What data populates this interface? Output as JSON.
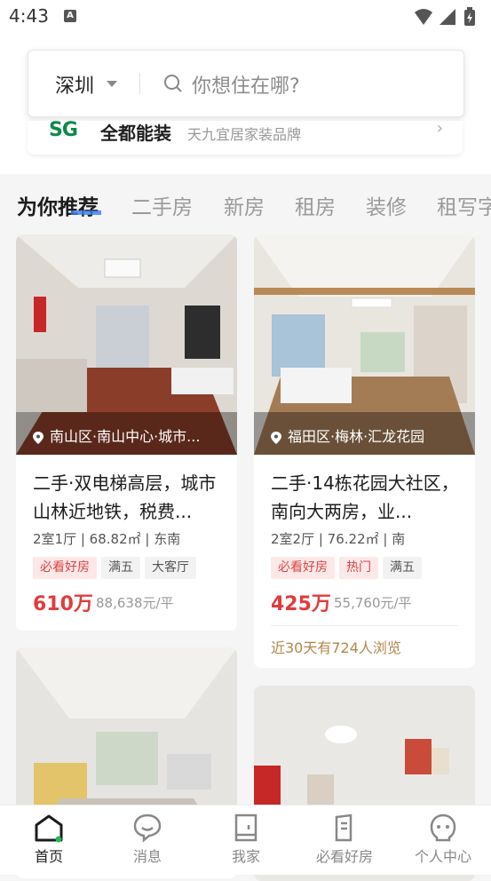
{
  "status_bar": {
    "time": "4:43",
    "notif_glyph": "A"
  },
  "search": {
    "city": "深圳",
    "placeholder": "你想住在哪?"
  },
  "banner": {
    "logo": "SG",
    "title": "全都能装",
    "subtitle": "天九宜居家装品牌"
  },
  "tabs": [
    {
      "label": "为你推荐",
      "active": true
    },
    {
      "label": "二手房"
    },
    {
      "label": "新房"
    },
    {
      "label": "租房"
    },
    {
      "label": "装修"
    },
    {
      "label": "租写字楼"
    }
  ],
  "listings": [
    {
      "location": "南山区·南山中心·城市...",
      "title": "二手·双电梯高层，城市山林近地铁，税费...",
      "info": "2室1厅 | 68.82㎡ | 东南",
      "tags": [
        {
          "label": "必看好房",
          "type": "hot"
        },
        {
          "label": "满五"
        },
        {
          "label": "大客厅"
        }
      ],
      "price": "610万",
      "unit_price": "88,638元/平"
    },
    {
      "location": "福田区·梅林·汇龙花园",
      "title": "二手·14栋花园大社区，南向大两房，业...",
      "info": "2室2厅 | 76.22㎡ | 南",
      "tags": [
        {
          "label": "必看好房",
          "type": "hot"
        },
        {
          "label": "热门",
          "type": "hot"
        },
        {
          "label": "满五"
        }
      ],
      "price": "425万",
      "unit_price": "55,760元/平",
      "views": "近30天有724人浏览"
    }
  ],
  "nav": [
    {
      "label": "首页",
      "icon": "home-icon",
      "active": true
    },
    {
      "label": "消息",
      "icon": "message-icon"
    },
    {
      "label": "我家",
      "icon": "my-home-icon"
    },
    {
      "label": "必看好房",
      "icon": "must-see-icon"
    },
    {
      "label": "个人中心",
      "icon": "profile-icon"
    }
  ],
  "colors": {
    "accent": "#e03c3c",
    "brand_green": "#0b8a4a",
    "tab_indicator": "#3b7cf0",
    "views_gold": "#b3864a"
  }
}
